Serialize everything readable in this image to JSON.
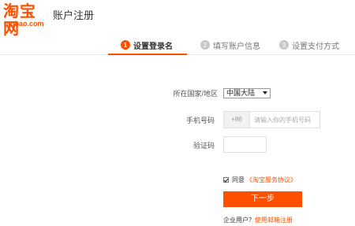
{
  "header": {
    "logo_main": "淘宝网",
    "logo_sub": "taobao.com",
    "title": "账户注册"
  },
  "steps": [
    {
      "num": "1",
      "label": "设置登录名",
      "active": true
    },
    {
      "num": "2",
      "label": "填写账户信息",
      "active": false
    },
    {
      "num": "3",
      "label": "设置支付方式",
      "active": false
    }
  ],
  "form": {
    "region_label": "所在国家/地区",
    "region_value": "中国大陆",
    "phone_label": "手机号码",
    "phone_prefix": "+86",
    "phone_placeholder": "请输入你的手机号码",
    "code_label": "验证码",
    "agree_text": "同意",
    "agree_link": "《淘宝服务协议》",
    "next_label": "下一步",
    "biz_text": "企业用户？",
    "biz_link": "使用邮箱注册"
  },
  "colors": {
    "accent": "#ff5000",
    "step_inactive": "#c8c8c8"
  }
}
